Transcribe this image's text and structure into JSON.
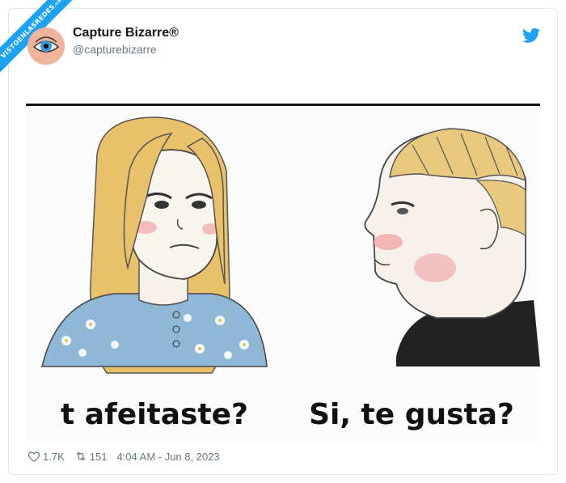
{
  "watermark": {
    "text": "VISTOENLASREDES",
    "suffix": ".com"
  },
  "tweet": {
    "display_name": "Capture Bizarre®",
    "handle": "@capturebizarre",
    "left_caption": "t afeitaste?",
    "right_caption": "Si, te gusta?",
    "likes": "1.7K",
    "retweets": "151",
    "timestamp": "4:04 AM - Jun 8, 2023"
  },
  "icons": {
    "avatar": "eye-icon",
    "brand": "twitter-bird-icon",
    "like": "heart-icon",
    "retweet": "retweet-icon"
  },
  "colors": {
    "accent": "#1da1f2",
    "muted": "#657786"
  }
}
